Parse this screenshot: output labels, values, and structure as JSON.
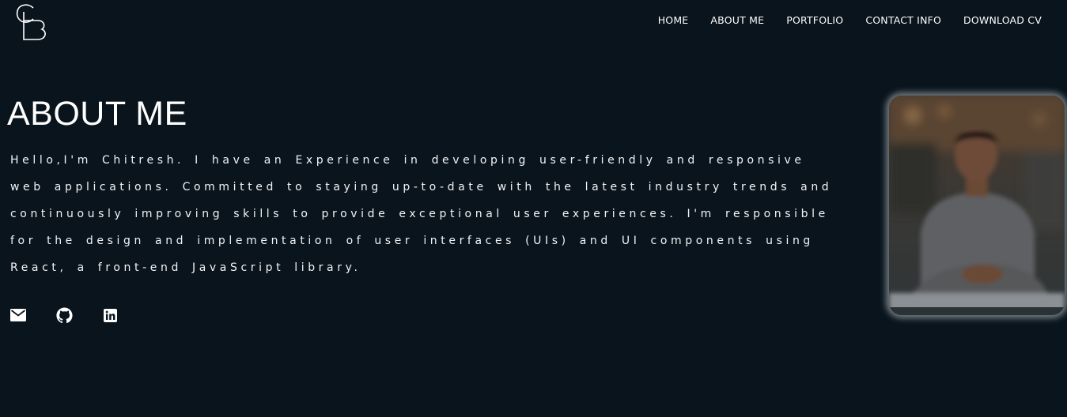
{
  "logo": {
    "icon": "cb-monogram-logo"
  },
  "nav": {
    "items": [
      {
        "label": "HOME"
      },
      {
        "label": "ABOUT ME"
      },
      {
        "label": "PORTFOLIO"
      },
      {
        "label": "CONTACT INFO"
      },
      {
        "label": "DOWNLOAD CV"
      }
    ]
  },
  "about": {
    "title": "ABOUT ME",
    "bio": "Hello,I'm Chitresh. I have an Experience in developing user-friendly and responsive web applications. Committed to staying up-to-date with the latest industry trends and continuously improving skills to provide exceptional user experiences. I'm responsible for the design and implementation of user interfaces (UIs) and UI components using React, a front-end JavaScript library."
  },
  "socials": [
    {
      "icon": "mail-icon"
    },
    {
      "icon": "github-icon"
    },
    {
      "icon": "linkedin-icon"
    }
  ],
  "profile_photo": {
    "icon": "profile-photo"
  },
  "colors": {
    "background": "#0a141c",
    "text": "#ffffff"
  }
}
